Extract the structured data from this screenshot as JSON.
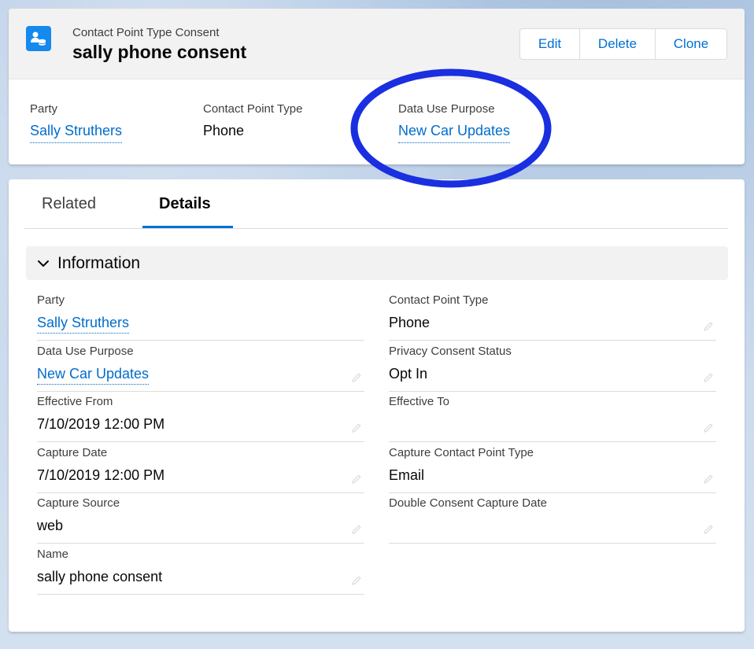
{
  "header": {
    "object_label": "Contact Point Type Consent",
    "title": "sally phone consent",
    "icon": "consent-record-icon",
    "buttons": {
      "edit": "Edit",
      "delete": "Delete",
      "clone": "Clone"
    }
  },
  "highlights": [
    {
      "label": "Party",
      "value": "Sally Struthers",
      "link": true
    },
    {
      "label": "Contact Point Type",
      "value": "Phone",
      "link": false
    },
    {
      "label": "Data Use Purpose",
      "value": "New Car Updates",
      "link": true
    }
  ],
  "tabs": {
    "related": "Related",
    "details": "Details",
    "active": "Details"
  },
  "section": {
    "title": "Information",
    "icon": "chevron-down-icon"
  },
  "fields": {
    "left": [
      {
        "label": "Party",
        "value": "Sally Struthers",
        "link": true,
        "editable": false
      },
      {
        "label": "Data Use Purpose",
        "value": "New Car Updates",
        "link": true,
        "editable": true
      },
      {
        "label": "Effective From",
        "value": "7/10/2019 12:00 PM",
        "link": false,
        "editable": true
      },
      {
        "label": "Capture Date",
        "value": "7/10/2019 12:00 PM",
        "link": false,
        "editable": true
      },
      {
        "label": "Capture Source",
        "value": "web",
        "link": false,
        "editable": true
      },
      {
        "label": "Name",
        "value": "sally phone consent",
        "link": false,
        "editable": true
      }
    ],
    "right": [
      {
        "label": "Contact Point Type",
        "value": "Phone",
        "link": false,
        "editable": true
      },
      {
        "label": "Privacy Consent Status",
        "value": "Opt In",
        "link": false,
        "editable": true
      },
      {
        "label": "Effective To",
        "value": "",
        "link": false,
        "editable": true
      },
      {
        "label": "Capture Contact Point Type",
        "value": "Email",
        "link": false,
        "editable": true
      },
      {
        "label": "Double Consent Capture Date",
        "value": "",
        "link": false,
        "editable": true
      }
    ]
  },
  "colors": {
    "brand": "#0070d2",
    "link": "#006dcc",
    "annotation": "#1a2fe0",
    "icon_bg": "#1589ee"
  }
}
